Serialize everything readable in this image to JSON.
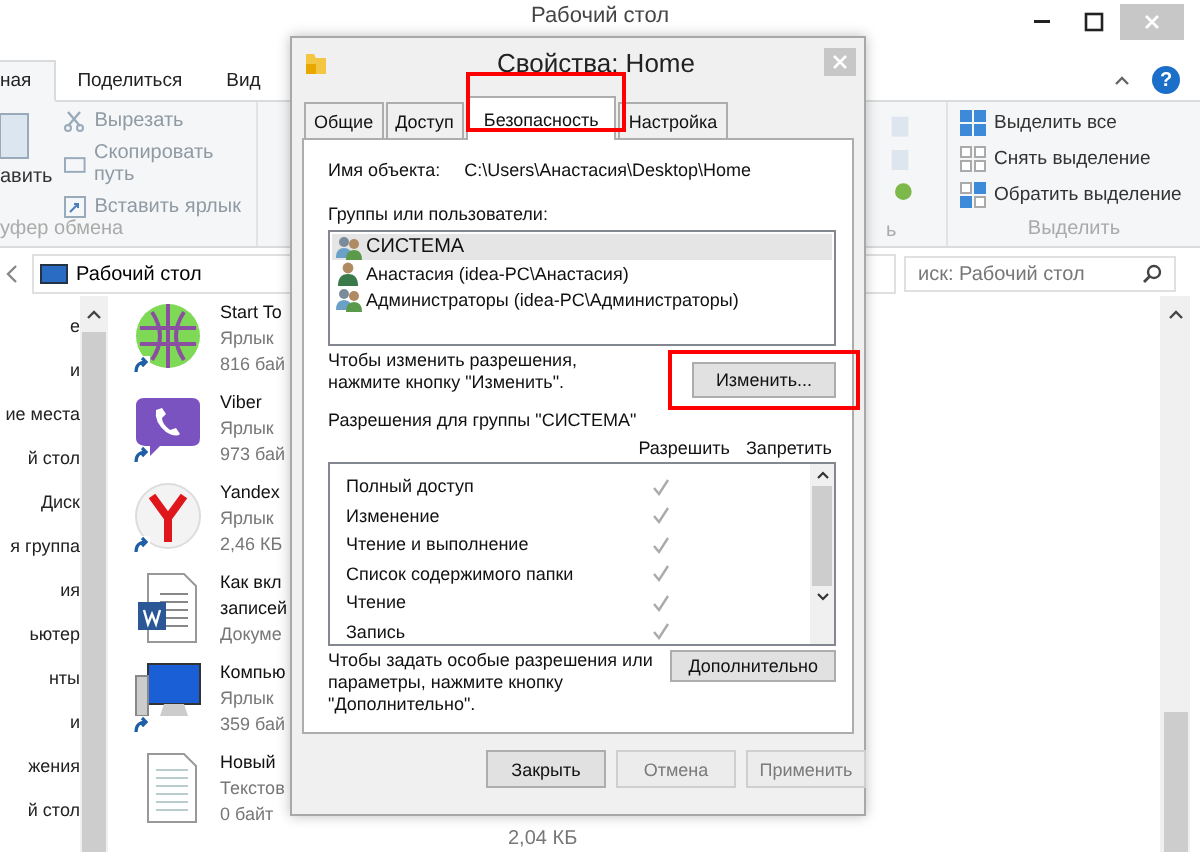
{
  "explorer": {
    "title": "Рабочий стол",
    "ribbon_tabs": [
      {
        "label": "ная",
        "selected": true
      },
      {
        "label": "Поделиться",
        "selected": false
      },
      {
        "label": "Вид",
        "selected": false
      }
    ],
    "help_label": "?",
    "clipboard": {
      "paste_label": "авить",
      "commands": [
        "Вырезать",
        "Скопировать путь",
        "Вставить ярлык"
      ],
      "group_label": "уфер обмена"
    },
    "open_group_label": "ь",
    "select": {
      "commands": [
        "Выделить все",
        "Снять выделение",
        "Обратить выделение"
      ],
      "group_label": "Выделить"
    },
    "address": "Рабочий стол",
    "search": {
      "placeholder": "иск: Рабочий стол"
    },
    "nav_items": [
      "е",
      "и",
      "ие места",
      "й стол",
      "Диск",
      "я группа",
      "ия",
      "ьютер",
      "нты",
      "и",
      "жения",
      "й стол"
    ],
    "files": [
      {
        "kind": "globe",
        "name": "Start To",
        "type": "Ярлык",
        "size": "816 бай",
        "shortcut": true
      },
      {
        "kind": "viber",
        "name": "Viber",
        "type": "Ярлык",
        "size": "973 бай",
        "shortcut": true
      },
      {
        "kind": "yandex",
        "name": "Yandex",
        "type": "Ярлык",
        "size": "2,46 КБ",
        "shortcut": true
      },
      {
        "kind": "word",
        "name": "Как вкл",
        "name2": "записей",
        "type": "Докуме",
        "shortcut": false
      },
      {
        "kind": "computer",
        "name": "Компью",
        "type": "Ярлык",
        "size": "359 бай",
        "shortcut": true
      },
      {
        "kind": "text",
        "name": "Новый",
        "type": "Текстов",
        "size": "0 байт",
        "shortcut": false
      }
    ],
    "hidden_size": "2,04 КБ"
  },
  "dialog": {
    "title": "Свойства: Home",
    "tabs": [
      {
        "label": "Общие",
        "selected": false
      },
      {
        "label": "Доступ",
        "selected": false
      },
      {
        "label": "Безопасность",
        "selected": true
      },
      {
        "label": "Настройка",
        "selected": false
      }
    ],
    "object_label": "Имя объекта:",
    "object_value": "C:\\Users\\Анастасия\\Desktop\\Home",
    "groups_label": "Группы или пользователи:",
    "groups": [
      {
        "kind": "group",
        "name": "СИСТЕМА",
        "selected": true
      },
      {
        "kind": "user",
        "name": "Анастасия (idea-PC\\Анастасия)",
        "selected": false
      },
      {
        "kind": "group",
        "name": "Администраторы (idea-PC\\Администраторы)",
        "selected": false
      }
    ],
    "change_hint": "Чтобы изменить разрешения, нажмите кнопку \"Изменить\".",
    "change_button": "Изменить...",
    "perms_label": "Разрешения для группы \"СИСТЕМА\"",
    "allow_header": "Разрешить",
    "deny_header": "Запретить",
    "permissions": [
      {
        "name": "Полный доступ",
        "allow": true,
        "deny": false
      },
      {
        "name": "Изменение",
        "allow": true,
        "deny": false
      },
      {
        "name": "Чтение и выполнение",
        "allow": true,
        "deny": false
      },
      {
        "name": "Список содержимого папки",
        "allow": true,
        "deny": false
      },
      {
        "name": "Чтение",
        "allow": true,
        "deny": false
      },
      {
        "name": "Запись",
        "allow": true,
        "deny": false
      }
    ],
    "advanced_hint": "Чтобы задать особые разрешения или параметры, нажмите кнопку \"Дополнительно\".",
    "advanced_button": "Дополнительно",
    "buttons": [
      {
        "label": "Закрыть",
        "disabled": false
      },
      {
        "label": "Отмена",
        "disabled": true
      },
      {
        "label": "Применить",
        "disabled": true
      }
    ]
  }
}
